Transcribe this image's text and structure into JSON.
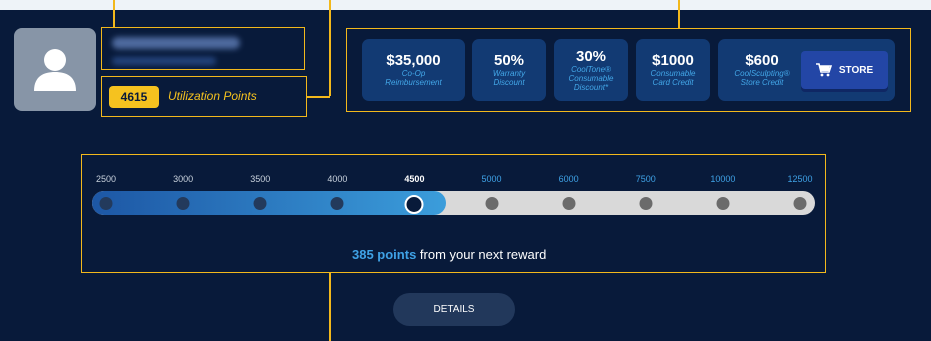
{
  "user": {
    "points_value": "4615",
    "points_label": "Utilization Points"
  },
  "rewards": [
    {
      "value": "$35,000",
      "lines": [
        "Co-Op",
        "Reimbursement"
      ]
    },
    {
      "value": "50%",
      "lines": [
        "Warranty",
        "Discount"
      ]
    },
    {
      "value": "30%",
      "lines": [
        "CoolTone®",
        "Consumable",
        "Discount*"
      ]
    },
    {
      "value": "$1000",
      "lines": [
        "Consumable",
        "Card Credit"
      ]
    },
    {
      "value": "$600",
      "lines": [
        "CoolSculpting®",
        "Store Credit"
      ]
    }
  ],
  "store_button": {
    "label": "STORE",
    "icon": "cart-icon"
  },
  "progress": {
    "ticks": [
      "2500",
      "3000",
      "3500",
      "4000",
      "4500",
      "5000",
      "6000",
      "7500",
      "10000",
      "12500"
    ],
    "current_index": 4,
    "fill_fraction": 0.49,
    "next_reward_points": "385 points",
    "next_reward_text": " from your next reward"
  },
  "details_button": {
    "label": "DETAILS"
  },
  "colors": {
    "panel": "#081a3a",
    "accent": "#f5c21f",
    "highlight": "#3fa2e6",
    "tile": "#123a73"
  }
}
